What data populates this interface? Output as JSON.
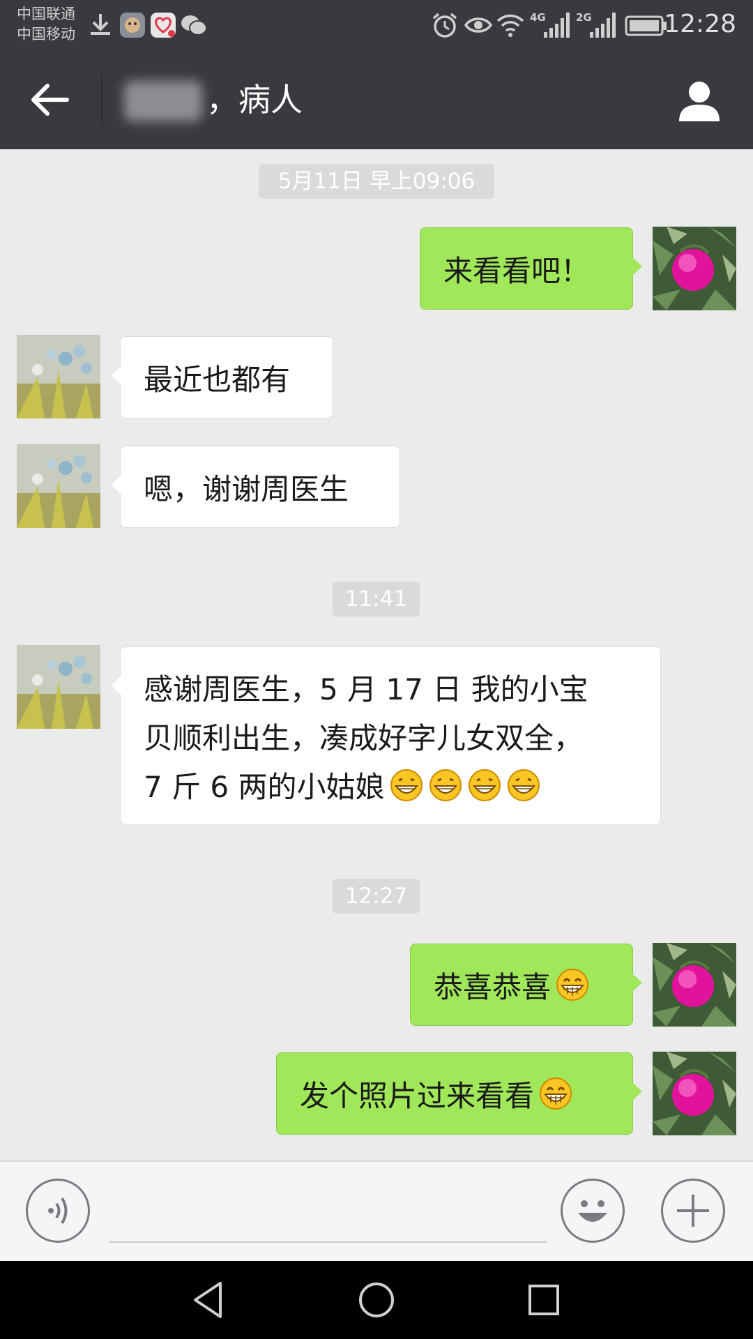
{
  "status_bar": {
    "carrier_1": "中国联通",
    "carrier_2": "中国移动",
    "network_1": "4G",
    "network_2": "2G",
    "time": "12:28",
    "icons": [
      "download-icon",
      "app-notification-icon",
      "health-app-icon",
      "wechat-icon",
      "alarm-icon",
      "eye-icon",
      "wifi-icon",
      "signal-icon",
      "signal-icon",
      "battery-icon"
    ]
  },
  "header": {
    "back_icon": "back-arrow-icon",
    "title": "，病人",
    "profile_icon": "person-icon"
  },
  "messages": [
    {
      "type": "time",
      "text": "5月11日 早上09:06"
    },
    {
      "type": "out",
      "text": "来看看吧！"
    },
    {
      "type": "in",
      "text": "最近也都有"
    },
    {
      "type": "in",
      "text": "嗯，谢谢周医生"
    },
    {
      "type": "time",
      "text": "11:41"
    },
    {
      "type": "in",
      "lines": [
        "感谢周医生，5 月 17 日 我的小宝",
        "贝顺利出生，凑成好字儿女双全，",
        "7 斤 6 两的小姑娘"
      ],
      "emoji": "grin-emoji",
      "emoji_count": 4
    },
    {
      "type": "time",
      "text": "12:27"
    },
    {
      "type": "out",
      "text": "恭喜恭喜",
      "emoji": "laugh-emoji"
    },
    {
      "type": "out",
      "text": "发个照片过来看看",
      "emoji": "laugh-emoji"
    }
  ],
  "input_bar": {
    "voice_icon": "voice-icon",
    "emoji_icon": "emoji-icon",
    "plus_icon": "plus-icon",
    "input_value": ""
  },
  "nav_bar": {
    "icons": [
      "back-triangle-icon",
      "home-circle-icon",
      "recents-square-icon"
    ]
  },
  "colors": {
    "header_bg": "#393a3f",
    "chat_bg": "#ebebeb",
    "outgoing_bubble": "#a0e75a",
    "incoming_bubble": "#ffffff"
  }
}
